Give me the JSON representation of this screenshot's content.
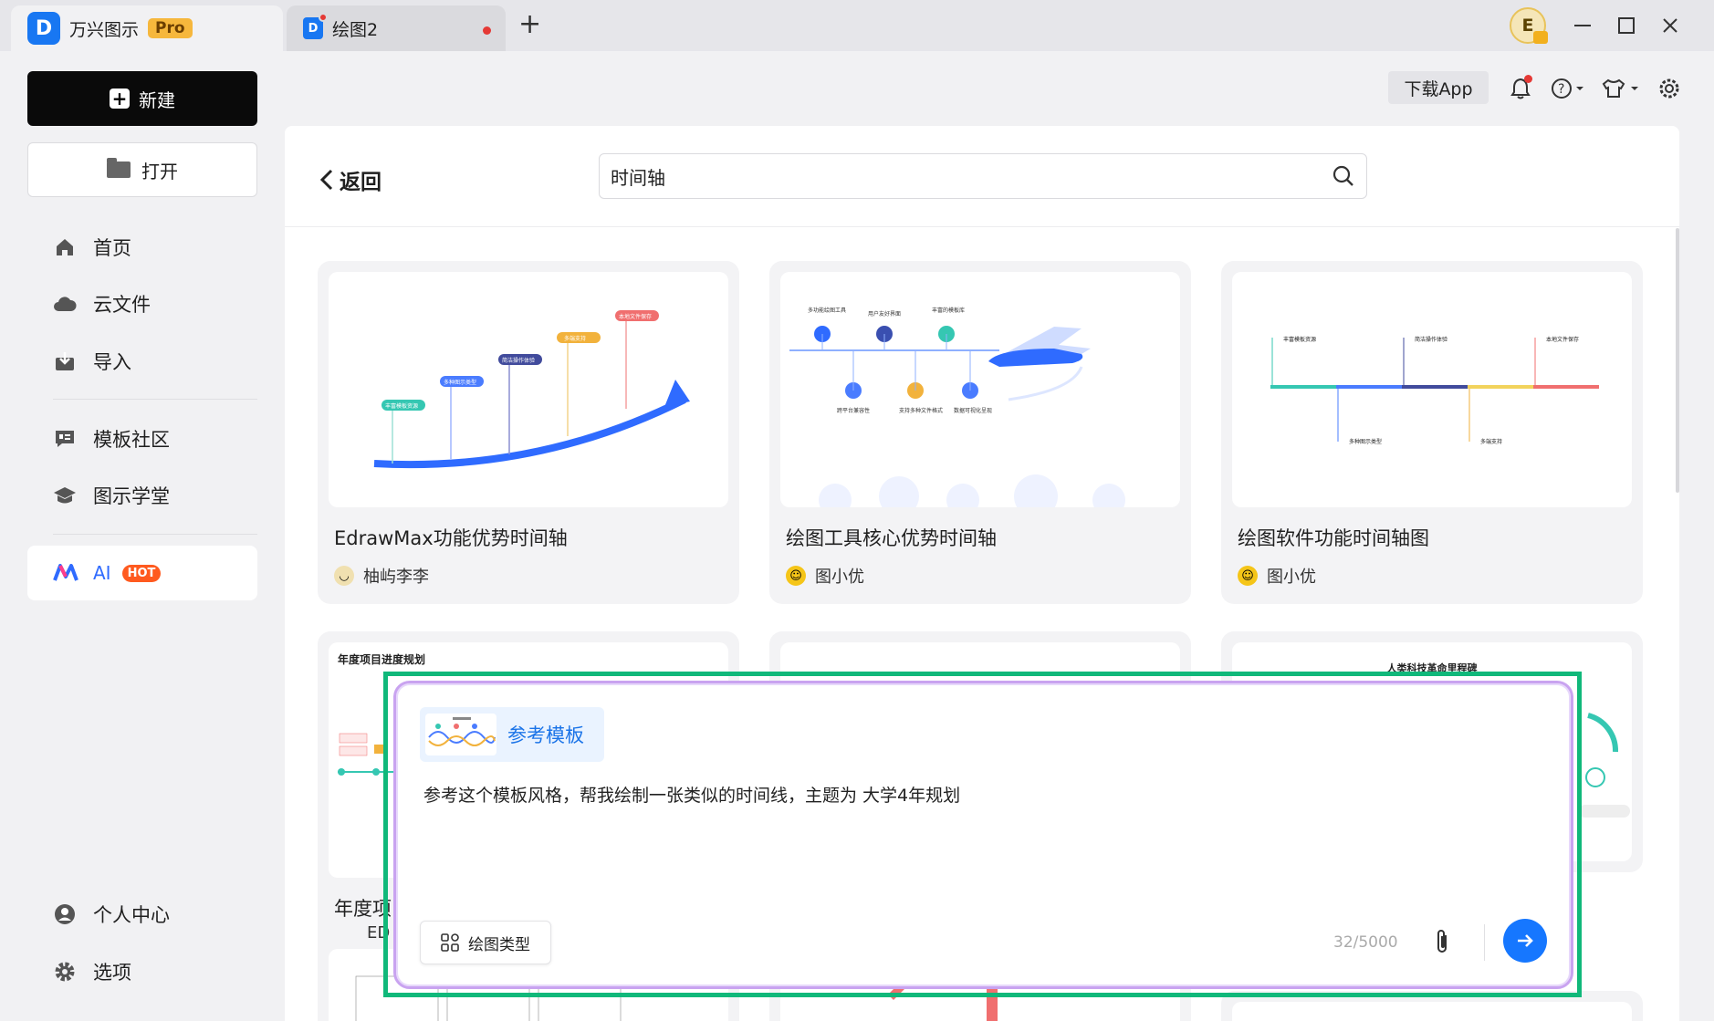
{
  "titlebar": {
    "app_tab_title": "万兴图示",
    "pro_badge": "Pro",
    "doc_tab_title": "绘图2",
    "new_tab": "+",
    "avatar_initial": "E"
  },
  "sidebar": {
    "new_label": "新建",
    "open_label": "打开",
    "items": [
      {
        "label": "首页",
        "icon": "home-icon"
      },
      {
        "label": "云文件",
        "icon": "cloud-icon"
      },
      {
        "label": "导入",
        "icon": "import-icon"
      },
      {
        "label": "模板社区",
        "icon": "template-community-icon"
      },
      {
        "label": "图示学堂",
        "icon": "graduation-cap-icon"
      }
    ],
    "ai_label": "AI",
    "ai_badge": "HOT",
    "bottom_items": [
      {
        "label": "个人中心",
        "icon": "user-icon"
      },
      {
        "label": "选项",
        "icon": "gear-icon"
      }
    ]
  },
  "header": {
    "download_label": "下载App"
  },
  "main": {
    "back_label": "返回",
    "search_value": "时间轴",
    "cards": [
      {
        "title": "EdrawMax功能优势时间轴",
        "author": "柚屿李李"
      },
      {
        "title": "绘图工具核心优势时间轴",
        "author": "图小优"
      },
      {
        "title": "绘图软件功能时间轴图",
        "author": "图小优"
      },
      {
        "title": "年度项",
        "author": "ED",
        "thumb_title": "年度项目进度规划"
      },
      {
        "title": "",
        "author": ""
      },
      {
        "title": "",
        "author": "",
        "thumb_title": "人类科技革命里程碑"
      }
    ],
    "thumb1_labels": [
      "丰富模板资源",
      "多种图示类型",
      "简洁操作体验",
      "多端支持",
      "本地文件保存"
    ],
    "thumb2_labels": [
      "多功能绘图工具",
      "用户友好界面",
      "丰富的模板库",
      "跨平台兼容性",
      "支持多种文件格式",
      "数据可视化呈现"
    ],
    "thumb3_labels": [
      "丰富模板资源",
      "简洁操作体验",
      "本地文件保存",
      "多种图示类型",
      "多端支持"
    ]
  },
  "ai_dialog": {
    "ref_label": "参考模板",
    "prompt": "参考这个模板风格，帮我绘制一张类似的时间线，主题为 大学4年规划",
    "type_label": "绘图类型",
    "counter": "32/5000"
  },
  "colors": {
    "accent": "#1677ff",
    "highlight_outline": "#10b87a",
    "hot": "#ff5a1f"
  }
}
